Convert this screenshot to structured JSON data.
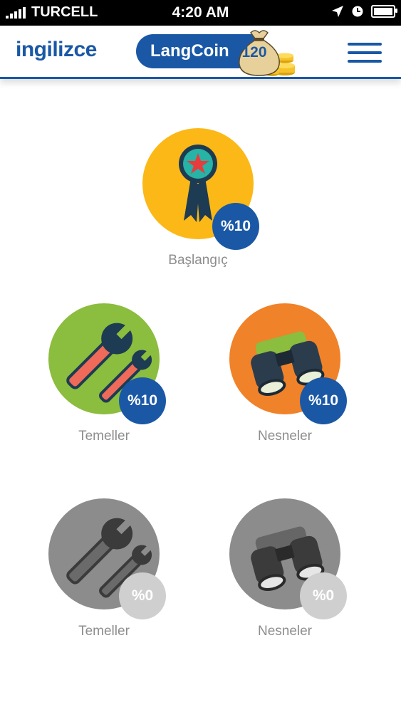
{
  "status_bar": {
    "carrier": "TURCELL",
    "time": "4:20 AM"
  },
  "header": {
    "brand": "ingilizce",
    "coin_label": "LangCoin",
    "coin_count": "120"
  },
  "units": [
    {
      "title": "Başlangıç",
      "progress": "%10",
      "icon": "ribbon-award-icon",
      "color": "#fbb817",
      "locked": false
    },
    {
      "title": "Temeller",
      "progress": "%10",
      "icon": "wrench-tools-icon",
      "color": "#8bbd3e",
      "locked": false
    },
    {
      "title": "Nesneler",
      "progress": "%10",
      "icon": "binoculars-icon",
      "color": "#f0822a",
      "locked": false
    },
    {
      "title": "Temeller",
      "progress": "%0",
      "icon": "wrench-tools-icon",
      "color": "#8c8c8c",
      "locked": true
    },
    {
      "title": "Nesneler",
      "progress": "%0",
      "icon": "binoculars-icon",
      "color": "#8c8c8c",
      "locked": true
    }
  ],
  "colors": {
    "primary": "#1a58a6",
    "badge_active": "#1a58a6",
    "badge_locked": "#cfcfcf"
  }
}
